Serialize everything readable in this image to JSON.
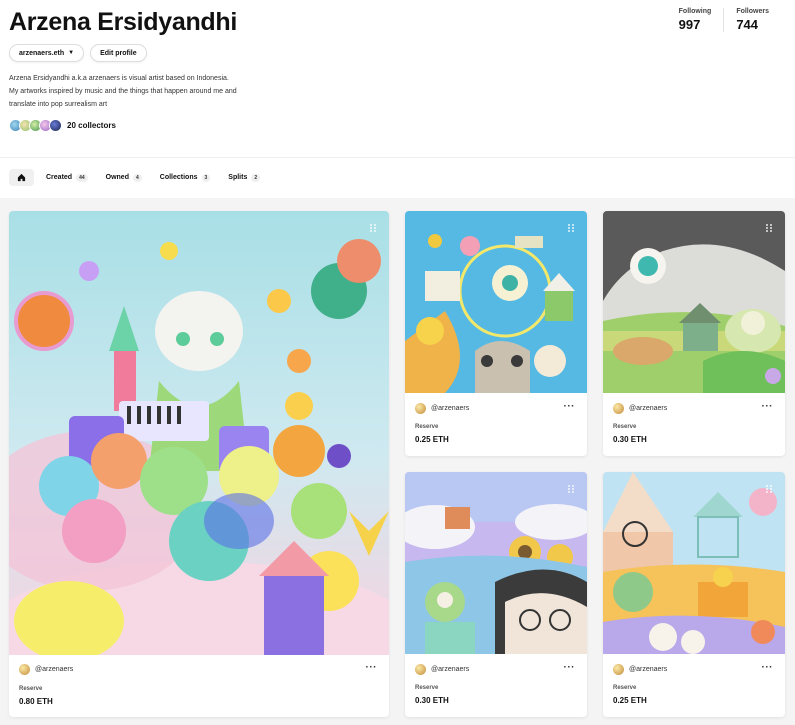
{
  "profile": {
    "name": "Arzena Ersidyandhi",
    "handle": "arzenaers.eth",
    "edit_label": "Edit profile",
    "bio": [
      "Arzena Ersidyandhi a.k.a arzenaers is visual artist based on Indonesia.",
      "My artworks inspired by music and the things that happen around me and",
      "translate into pop surrealism art"
    ],
    "collectors_label": "20 collectors"
  },
  "stats": {
    "following_label": "Following",
    "following_value": "997",
    "followers_label": "Followers",
    "followers_value": "744"
  },
  "tabs": [
    {
      "label": "Created",
      "count": "44"
    },
    {
      "label": "Owned",
      "count": "4"
    },
    {
      "label": "Collections",
      "count": "3"
    },
    {
      "label": "Splits",
      "count": "2"
    }
  ],
  "cards": [
    {
      "creator": "@arzenaers",
      "reserve_label": "Reserve",
      "price": "0.80 ETH"
    },
    {
      "creator": "@arzenaers",
      "reserve_label": "Reserve",
      "price": "0.25 ETH"
    },
    {
      "creator": "@arzenaers",
      "reserve_label": "Reserve",
      "price": "0.30 ETH"
    },
    {
      "creator": "@arzenaers",
      "reserve_label": "Reserve",
      "price": "0.30 ETH"
    },
    {
      "creator": "@arzenaers",
      "reserve_label": "Reserve",
      "price": "0.25 ETH"
    }
  ],
  "more_glyph": "···",
  "icons": {
    "home": "home-icon",
    "chevron": "chevron-down-icon",
    "grip": "drag-grip-icon",
    "more": "more-options-icon"
  },
  "colors": {
    "accent": "#111111",
    "background": "#f4f4f4"
  }
}
